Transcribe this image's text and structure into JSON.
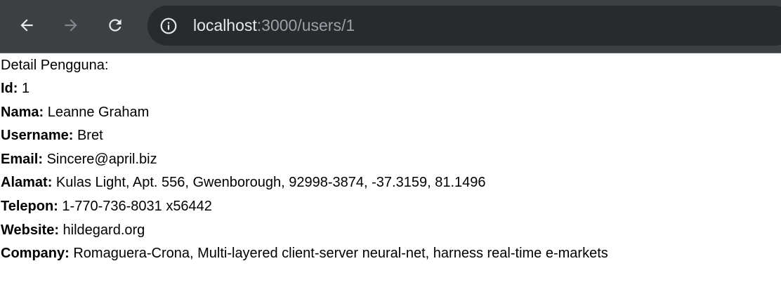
{
  "browser": {
    "url_host": "localhost",
    "url_path": ":3000/users/1",
    "icons": {
      "back": "arrow-left-icon",
      "forward": "arrow-right-icon",
      "reload": "reload-icon",
      "site_info": "info-circle-icon"
    },
    "colors": {
      "toolbar_bg": "#3c4043",
      "omnibox_bg": "#282a2d",
      "url_host": "#e8eaed",
      "url_path": "#9aa0a6"
    }
  },
  "page": {
    "heading": "Detail Pengguna:",
    "fields": [
      {
        "label": "Id:",
        "value": "1"
      },
      {
        "label": "Nama:",
        "value": "Leanne Graham"
      },
      {
        "label": "Username:",
        "value": "Bret"
      },
      {
        "label": "Email:",
        "value": "Sincere@april.biz"
      },
      {
        "label": "Alamat:",
        "value": "Kulas Light, Apt. 556, Gwenborough, 92998-3874, -37.3159, 81.1496"
      },
      {
        "label": "Telepon:",
        "value": "1-770-736-8031 x56442"
      },
      {
        "label": "Website:",
        "value": "hildegard.org"
      },
      {
        "label": "Company:",
        "value": "Romaguera-Crona, Multi-layered client-server neural-net, harness real-time e-markets"
      }
    ]
  }
}
